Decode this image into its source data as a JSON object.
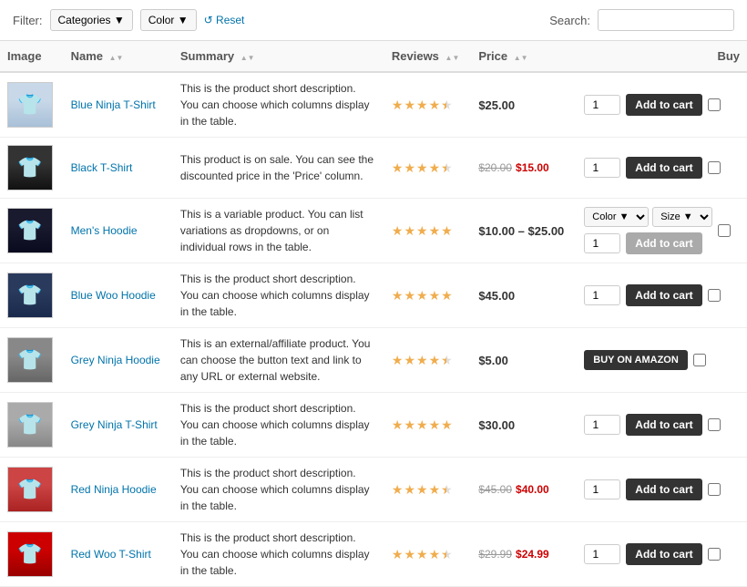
{
  "toolbar": {
    "filter_label": "Filter:",
    "categories_btn": "Categories ▼",
    "color_btn": "Color ▼",
    "reset_label": "↺ Reset",
    "search_label": "Search:",
    "search_placeholder": ""
  },
  "table": {
    "headers": [
      {
        "key": "image",
        "label": "Image"
      },
      {
        "key": "name",
        "label": "Name"
      },
      {
        "key": "summary",
        "label": "Summary"
      },
      {
        "key": "reviews",
        "label": "Reviews"
      },
      {
        "key": "price",
        "label": "Price"
      },
      {
        "key": "buy",
        "label": "Buy"
      }
    ],
    "products": [
      {
        "id": 1,
        "imgClass": "img-blue",
        "name": "Blue Ninja T-Shirt",
        "summary": "This is the product short description. You can choose which columns display in the table.",
        "stars": 4.5,
        "price_display": "$25.00",
        "price_original": null,
        "price_sale": null,
        "qty": 1,
        "buy_type": "add",
        "buy_label": "Add to cart",
        "variation": false
      },
      {
        "id": 2,
        "imgClass": "img-black",
        "name": "Black T-Shirt",
        "summary": "This product is on sale. You can see the discounted price in the 'Price' column.",
        "stars": 4.5,
        "price_display": "$15.00",
        "price_original": "$20.00",
        "price_sale": "$15.00",
        "qty": 1,
        "buy_type": "add",
        "buy_label": "Add to cart",
        "variation": false
      },
      {
        "id": 3,
        "imgClass": "img-darkblue",
        "name": "Men's Hoodie",
        "summary": "This is a variable product. You can list variations as dropdowns, or on individual rows in the table.",
        "stars": 5,
        "price_display": "$10.00 – $25.00",
        "price_original": null,
        "price_sale": null,
        "qty": 1,
        "buy_type": "variation",
        "buy_label": "Add to cart",
        "variation": true,
        "variation_options": [
          "Color ▼",
          "Size ▼"
        ]
      },
      {
        "id": 4,
        "imgClass": "img-bluehoodie",
        "name": "Blue Woo Hoodie",
        "summary": "This is the product short description. You can choose which columns display in the table.",
        "stars": 5,
        "price_display": "$45.00",
        "price_original": null,
        "price_sale": null,
        "qty": 1,
        "buy_type": "add",
        "buy_label": "Add to cart",
        "variation": false
      },
      {
        "id": 5,
        "imgClass": "img-grey",
        "name": "Grey Ninja Hoodie",
        "summary": "This is an external/affiliate product. You can choose the button text and link to any URL or external website.",
        "stars": 4.5,
        "price_display": "$5.00",
        "price_original": null,
        "price_sale": null,
        "qty": null,
        "buy_type": "external",
        "buy_label": "BUY ON AMAZON",
        "variation": false
      },
      {
        "id": 6,
        "imgClass": "img-greytshirt",
        "name": "Grey Ninja T-Shirt",
        "summary": "This is the product short description. You can choose which columns display in the table.",
        "stars": 5,
        "price_display": "$30.00",
        "price_original": null,
        "price_sale": null,
        "qty": 1,
        "buy_type": "add",
        "buy_label": "Add to cart",
        "variation": false
      },
      {
        "id": 7,
        "imgClass": "img-red",
        "name": "Red Ninja Hoodie",
        "summary": "This is the product short description. You can choose which columns display in the table.",
        "stars": 4.5,
        "price_display": "$40.00",
        "price_original": "$45.00",
        "price_sale": "$40.00",
        "qty": 1,
        "buy_type": "add",
        "buy_label": "Add to cart",
        "variation": false
      },
      {
        "id": 8,
        "imgClass": "img-redtshirt",
        "name": "Red Woo T-Shirt",
        "summary": "This is the product short description. You can choose which columns display in the table.",
        "stars": 4.5,
        "price_display": "$24.99",
        "price_original": "$29.99",
        "price_sale": "$24.99",
        "qty": 1,
        "buy_type": "add",
        "buy_label": "Add to cart",
        "variation": false
      }
    ]
  }
}
